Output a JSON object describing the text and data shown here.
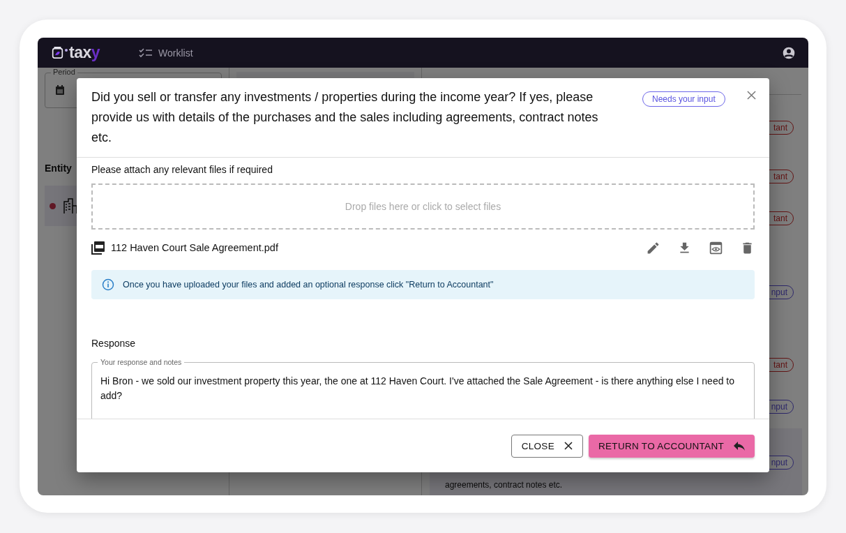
{
  "app_bar": {
    "logo": {
      "text": "tax",
      "accent": "y"
    },
    "nav": [
      {
        "label": "Worklist"
      }
    ]
  },
  "background": {
    "period_label": "Period",
    "entity_heading": "Entity",
    "status_pills": [
      {
        "text": "tant",
        "kind": "accountant"
      },
      {
        "text": "tant",
        "kind": "accountant"
      },
      {
        "text": "tant",
        "kind": "accountant"
      },
      {
        "text": "nput",
        "kind": "input"
      },
      {
        "text": "tant",
        "kind": "accountant"
      },
      {
        "text": "nput",
        "kind": "input"
      },
      {
        "text": "nput",
        "kind": "input"
      }
    ],
    "question_lines": [
      "agreements, contract notes etc."
    ]
  },
  "dialog": {
    "title": "Did you sell or transfer any investments / properties during the income year? If yes, please provide us with details of the purchases and the sales including agreements, contract notes etc.",
    "status_badge": "Needs your input",
    "attach_label": "Please attach any relevant files if required",
    "dropzone_text": "Drop files here or click to select files",
    "files": [
      {
        "name": "112 Haven Court Sale Agreement.pdf"
      }
    ],
    "info": "Once you have uploaded your files and added an optional response click \"Return to Accountant\"",
    "response_heading": "Response",
    "response_field": {
      "label": "Your response and notes",
      "value": "Hi Bron - we sold our investment property this year, the one at 112 Haven Court. I've attached the Sale Agreement - is there anything else I need to add?"
    },
    "buttons": [
      {
        "label": "CLOSE",
        "kind": "secondary"
      },
      {
        "label": "RETURN TO ACCOUNTANT",
        "kind": "primary"
      }
    ]
  }
}
